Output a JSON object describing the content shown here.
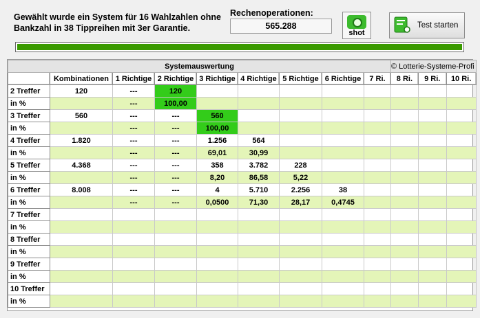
{
  "info_text": "Gewählt wurde ein System für 16 Wahlzahlen ohne Bankzahl in 38 Tippreihen mit 3er Garantie.",
  "ops": {
    "label": "Rechenoperationen:",
    "value": "565.288"
  },
  "buttons": {
    "shot": "shot",
    "test": "Test starten"
  },
  "progress": 1.0,
  "colors": {
    "accent": "#33cc1a",
    "pct_row": "#e4f5b8",
    "progress": "#3a9a00"
  },
  "table": {
    "title": "Systemauswertung",
    "copyright": "© Lotterie-Systeme-Profi",
    "headers": [
      "",
      "Kombinationen",
      "1 Richtige",
      "2 Richtige",
      "3 Richtige",
      "4 Richtige",
      "5 Richtige",
      "6 Richtige",
      "7 Ri.",
      "8 Ri.",
      "9 Ri.",
      "10 Ri."
    ],
    "rows": [
      {
        "label": "2 Treffer",
        "values": [
          "120",
          "---",
          "120",
          "",
          "",
          "",
          "",
          "",
          "",
          "",
          ""
        ],
        "hl": 2
      },
      {
        "label": "in %",
        "values": [
          "",
          "---",
          "100,00",
          "",
          "",
          "",
          "",
          "",
          "",
          "",
          ""
        ],
        "hl": 2
      },
      {
        "label": "3 Treffer",
        "values": [
          "560",
          "---",
          "---",
          "560",
          "",
          "",
          "",
          "",
          "",
          "",
          ""
        ],
        "hl": 3
      },
      {
        "label": "in %",
        "values": [
          "",
          "---",
          "---",
          "100,00",
          "",
          "",
          "",
          "",
          "",
          "",
          ""
        ],
        "hl": 3
      },
      {
        "label": "4 Treffer",
        "values": [
          "1.820",
          "---",
          "---",
          "1.256",
          "564",
          "",
          "",
          "",
          "",
          "",
          ""
        ]
      },
      {
        "label": "in %",
        "values": [
          "",
          "---",
          "---",
          "69,01",
          "30,99",
          "",
          "",
          "",
          "",
          "",
          ""
        ]
      },
      {
        "label": "5 Treffer",
        "values": [
          "4.368",
          "---",
          "---",
          "358",
          "3.782",
          "228",
          "",
          "",
          "",
          "",
          ""
        ]
      },
      {
        "label": "in %",
        "values": [
          "",
          "---",
          "---",
          "8,20",
          "86,58",
          "5,22",
          "",
          "",
          "",
          "",
          ""
        ]
      },
      {
        "label": "6 Treffer",
        "values": [
          "8.008",
          "---",
          "---",
          "4",
          "5.710",
          "2.256",
          "38",
          "",
          "",
          "",
          ""
        ]
      },
      {
        "label": "in %",
        "values": [
          "",
          "---",
          "---",
          "0,0500",
          "71,30",
          "28,17",
          "0,4745",
          "",
          "",
          "",
          ""
        ]
      },
      {
        "label": "7 Treffer",
        "values": [
          "",
          "",
          "",
          "",
          "",
          "",
          "",
          "",
          "",
          "",
          ""
        ]
      },
      {
        "label": "in %",
        "values": [
          "",
          "",
          "",
          "",
          "",
          "",
          "",
          "",
          "",
          "",
          ""
        ]
      },
      {
        "label": "8 Treffer",
        "values": [
          "",
          "",
          "",
          "",
          "",
          "",
          "",
          "",
          "",
          "",
          ""
        ]
      },
      {
        "label": "in %",
        "values": [
          "",
          "",
          "",
          "",
          "",
          "",
          "",
          "",
          "",
          "",
          ""
        ]
      },
      {
        "label": "9 Treffer",
        "values": [
          "",
          "",
          "",
          "",
          "",
          "",
          "",
          "",
          "",
          "",
          ""
        ]
      },
      {
        "label": "in %",
        "values": [
          "",
          "",
          "",
          "",
          "",
          "",
          "",
          "",
          "",
          "",
          ""
        ]
      },
      {
        "label": "10 Treffer",
        "values": [
          "",
          "",
          "",
          "",
          "",
          "",
          "",
          "",
          "",
          "",
          ""
        ]
      },
      {
        "label": "in %",
        "values": [
          "",
          "",
          "",
          "",
          "",
          "",
          "",
          "",
          "",
          "",
          ""
        ]
      }
    ]
  }
}
